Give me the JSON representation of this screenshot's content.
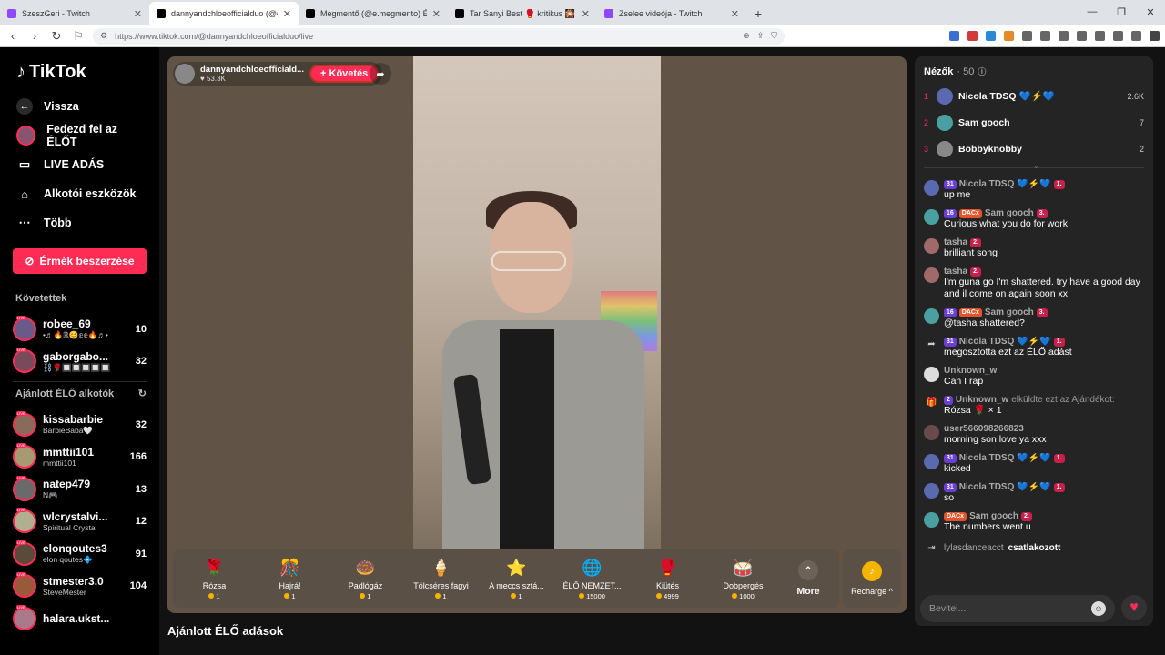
{
  "browser": {
    "tabs": [
      {
        "title": "SzeszGeri - Twitch",
        "color": "#9146ff",
        "active": false
      },
      {
        "title": "dannyandchloeofficialduo (@da",
        "color": "#000000",
        "active": true
      },
      {
        "title": "Megmentő (@e.megmento) ÉLŐ adá",
        "color": "#000000",
        "active": false
      },
      {
        "title": "Tar Sanyi Best 🥊 kritikus 🎇 (@szop",
        "color": "#000000",
        "active": false
      },
      {
        "title": "Zselee videója - Twitch",
        "color": "#9146ff",
        "active": false
      }
    ],
    "new_tab": "+",
    "url": "https://www.tiktok.com/@dannyandchloeofficialduo/live"
  },
  "sidebar": {
    "logo": "TikTok",
    "back": "Vissza",
    "nav": [
      {
        "label": "Fedezd fel az ÉLŐT",
        "icon": "explore-avatar-icon"
      },
      {
        "label": "LIVE ADÁS",
        "icon": "camera-icon"
      },
      {
        "label": "Alkotói eszközök",
        "icon": "home-icon"
      },
      {
        "label": "Több",
        "icon": "more-dots-icon"
      }
    ],
    "coin_button": "Érmék beszerzése",
    "following_title": "Követettek",
    "following": [
      {
        "name": "robee_69",
        "sub": "•♬🔥ℝ😊𝕖𝕖🔥♬•",
        "count": "10",
        "color": "#6a5a8a"
      },
      {
        "name": "gaborgabo...",
        "sub": "⛓️🌹🔲🔲🔲🔲🔲",
        "count": "32",
        "color": "#7a4a5a"
      }
    ],
    "recommended_title": "Ajánlott ÉLŐ alkotók",
    "recommended": [
      {
        "name": "kissabarbie",
        "sub": "BarbieBaba🤍",
        "count": "32",
        "color": "#8a6a5a"
      },
      {
        "name": "mmttii101",
        "sub": "mmttii101",
        "count": "166",
        "color": "#a89a70"
      },
      {
        "name": "natep479",
        "sub": "N🎮",
        "count": "13",
        "color": "#6a6a6a"
      },
      {
        "name": "wlcrystalvi...",
        "sub": "Spiritual Crystal",
        "count": "12",
        "color": "#b0b090"
      },
      {
        "name": "elonqoutes3",
        "sub": "elon qoutes💠",
        "count": "91",
        "color": "#5a4a3a"
      },
      {
        "name": "stmester3.0",
        "sub": "SteveMester",
        "count": "104",
        "color": "#9a5a3a"
      },
      {
        "name": "halara.ukst...",
        "sub": "",
        "count": "",
        "color": "#aa7a8a"
      }
    ]
  },
  "stage": {
    "host_name": "dannyandchloeofficiald...",
    "host_likes": "♥ 53.3K",
    "follow_label": "+ Követés",
    "gifts": [
      {
        "name": "Rózsa",
        "price": "1",
        "icon": "🌹"
      },
      {
        "name": "Hajrá!",
        "price": "1",
        "icon": "🎊"
      },
      {
        "name": "Padlógáz",
        "price": "1",
        "icon": "🍩"
      },
      {
        "name": "Tölcséres fagyi",
        "price": "1",
        "icon": "🍦"
      },
      {
        "name": "A meccs sztá...",
        "price": "1",
        "icon": "⭐"
      },
      {
        "name": "ÉLŐ NEMZET...",
        "price": "15000",
        "icon": "🌐"
      },
      {
        "name": "Kiütés",
        "price": "4999",
        "icon": "🥊"
      },
      {
        "name": "Dobpergés",
        "price": "1000",
        "icon": "🥁"
      }
    ],
    "more_label": "More",
    "recharge_label": "Recharge ^"
  },
  "below_title": "Ajánlott ÉLŐ adások",
  "chat": {
    "viewers_label": "Nézők",
    "viewers_count": "· 50",
    "top_viewers": [
      {
        "rank": "1",
        "name": "Nicola TDSQ 💙⚡💙",
        "score": "2.6K",
        "color": "#5a6ab0"
      },
      {
        "rank": "2",
        "name": "Sam gooch",
        "score": "7",
        "color": "#4aa0a0"
      },
      {
        "rank": "3",
        "name": "Bobbyknobby",
        "score": "2",
        "color": "#888888"
      }
    ],
    "messages": [
      {
        "user": "Nicola TDSQ",
        "badges": [
          "31"
        ],
        "extra": "💙⚡💙",
        "rank_badge": "1.",
        "text": "up me",
        "color": "#5a6ab0"
      },
      {
        "user": "Sam gooch",
        "badges": [
          "16",
          "DACx"
        ],
        "extra": "",
        "rank_badge": "3.",
        "text": "Curious what you do for work.",
        "color": "#4aa0a0"
      },
      {
        "user": "tasha",
        "badges": [],
        "extra": "",
        "rank_badge": "2.",
        "text": "brilliant song",
        "color": "#a06a6a"
      },
      {
        "user": "tasha",
        "badges": [],
        "extra": "",
        "rank_badge": "2.",
        "text": "I'm guna go I'm shattered. try have a good day and il come on again soon xx",
        "color": "#a06a6a"
      },
      {
        "user": "Sam gooch",
        "badges": [
          "16",
          "DACx"
        ],
        "extra": "",
        "rank_badge": "3.",
        "text": "@tasha shattered?",
        "color": "#4aa0a0"
      },
      {
        "user": "Nicola TDSQ",
        "badges": [
          "31"
        ],
        "extra": "💙⚡💙",
        "rank_badge": "1.",
        "text": "megosztotta ezt az ÉLŐ adást",
        "color": "",
        "system": "share"
      },
      {
        "user": "Unknown_w",
        "badges": [],
        "extra": "",
        "rank_badge": "",
        "text": "Can I rap",
        "color": "#dddddd"
      },
      {
        "user": "Unknown_w",
        "badges": [
          "2"
        ],
        "extra": "elküldte ezt az Ajándékot:",
        "rank_badge": "",
        "text": "Rózsa 🌹 × 1",
        "color": "",
        "system": "gift"
      },
      {
        "user": "user566098266823",
        "badges": [],
        "extra": "",
        "rank_badge": "",
        "text": "morning son love ya xxx",
        "color": "#6a4a4a"
      },
      {
        "user": "Nicola TDSQ",
        "badges": [
          "31"
        ],
        "extra": "💙⚡💙",
        "rank_badge": "1.",
        "text": "kicked",
        "color": "#5a6ab0"
      },
      {
        "user": "Nicola TDSQ",
        "badges": [
          "31"
        ],
        "extra": "💙⚡💙",
        "rank_badge": "1.",
        "text": "so",
        "color": "#5a6ab0"
      },
      {
        "user": "Sam gooch",
        "badges": [
          "DACx"
        ],
        "extra": "",
        "rank_badge": "2.",
        "text": "The numbers went u",
        "color": "#4aa0a0"
      }
    ],
    "joined_user": "lylasdanceacct",
    "joined_text": "csatlakozott",
    "input_placeholder": "Bevitel..."
  }
}
